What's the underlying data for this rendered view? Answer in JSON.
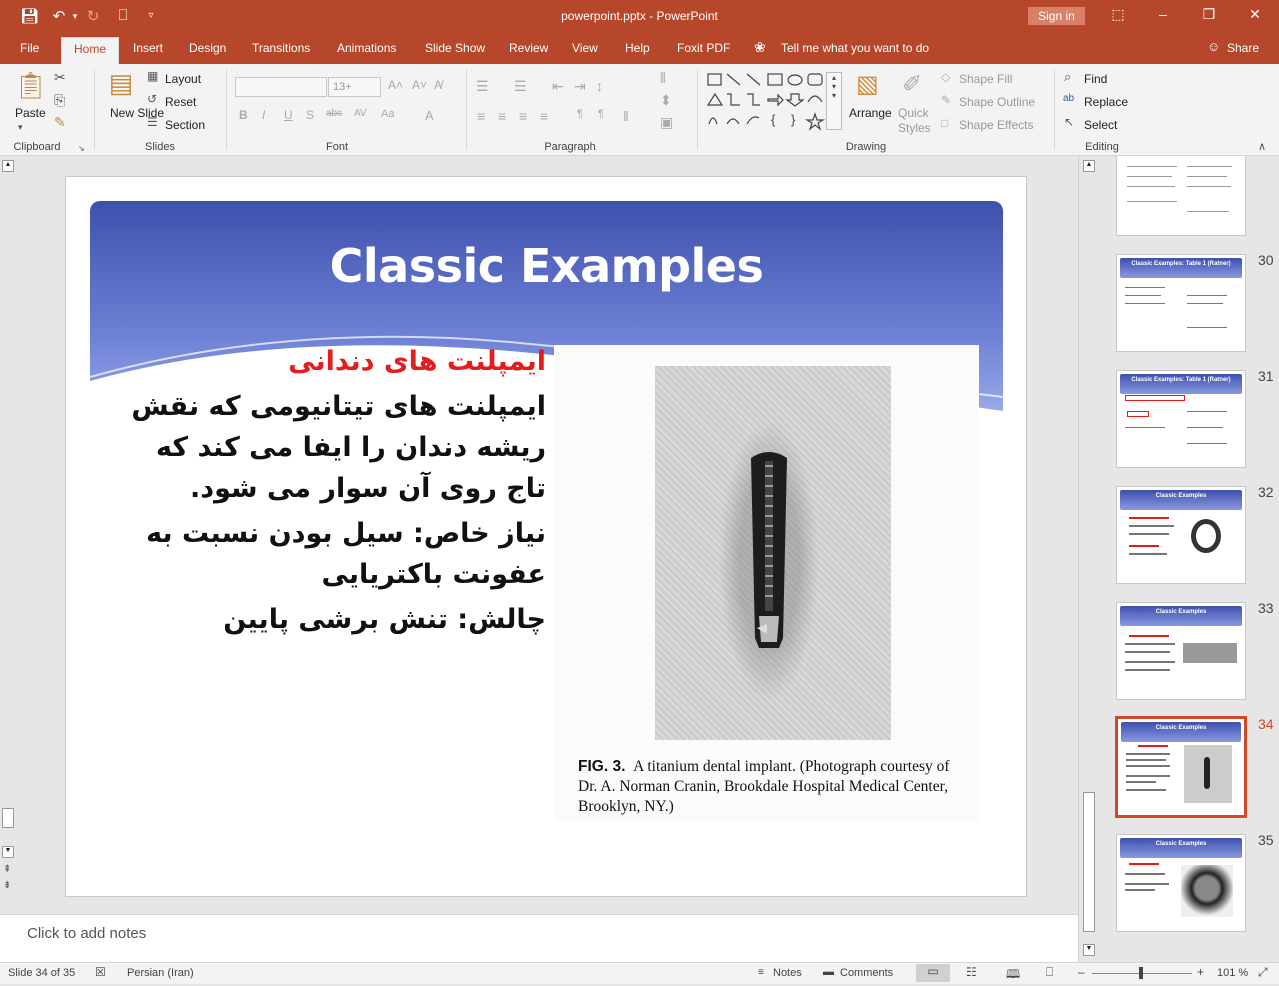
{
  "titlebar": {
    "title": "powerpoint.pptx - PowerPoint",
    "sign_in": "Sign in"
  },
  "tabs": [
    "File",
    "Home",
    "Insert",
    "Design",
    "Transitions",
    "Animations",
    "Slide Show",
    "Review",
    "View",
    "Help",
    "Foxit PDF"
  ],
  "tell_me": "Tell me what you want to do",
  "share": "Share",
  "ribbon": {
    "clipboard": {
      "paste": "Paste",
      "label": "Clipboard"
    },
    "slides": {
      "new_slide": "New Slide",
      "layout": "Layout",
      "reset": "Reset",
      "section": "Section",
      "label": "Slides"
    },
    "font": {
      "size": "13+",
      "label": "Font"
    },
    "paragraph": {
      "label": "Paragraph"
    },
    "drawing": {
      "arrange": "Arrange",
      "quick_styles": "Quick Styles",
      "shape_fill": "Shape Fill",
      "shape_outline": "Shape Outline",
      "shape_effects": "Shape Effects",
      "label": "Drawing"
    },
    "editing": {
      "find": "Find",
      "replace": "Replace",
      "select": "Select",
      "label": "Editing"
    }
  },
  "slide": {
    "title": "Classic Examples",
    "bullets": [
      {
        "text": "ایمپلنت های دندانی",
        "color": "#e31c1c"
      },
      {
        "text": "ایمپلنت های تیتانیومی که نقش ریشه دندان را ایفا می کند که تاج روی آن سوار می شود."
      },
      {
        "text": "نیاز خاص: سیل بودن نسبت به عفونت باکتریایی"
      },
      {
        "text": "چالش: تنش برشی پایین"
      }
    ],
    "figure_caption_label": "FIG. 3.",
    "figure_caption_text": "A titanium dental implant. (Photograph courtesy of Dr. A. Norman Cranin, Brookdale Hospital Medical Center, Brooklyn, NY.)"
  },
  "notes_placeholder": "Click to add notes",
  "thumbnails": [
    {
      "number": "",
      "title": ""
    },
    {
      "number": "30",
      "title": "Classic Examples: Table 1 (Ratner)"
    },
    {
      "number": "31",
      "title": "Classic Examples: Table 1 (Ratner)"
    },
    {
      "number": "32",
      "title": "Classic Examples"
    },
    {
      "number": "33",
      "title": "Classic Examples"
    },
    {
      "number": "34",
      "title": "Classic Examples",
      "selected": true
    },
    {
      "number": "35",
      "title": "Classic Examples"
    }
  ],
  "status": {
    "slide_info": "Slide 34 of 35",
    "language": "Persian (Iran)",
    "notes": "Notes",
    "comments": "Comments",
    "zoom": "101 %"
  },
  "colors": {
    "accent": "#b7472a",
    "banner": "#3e50ac",
    "bullet_star": "#4a5fcf",
    "selected_thumb": "#d24726"
  }
}
